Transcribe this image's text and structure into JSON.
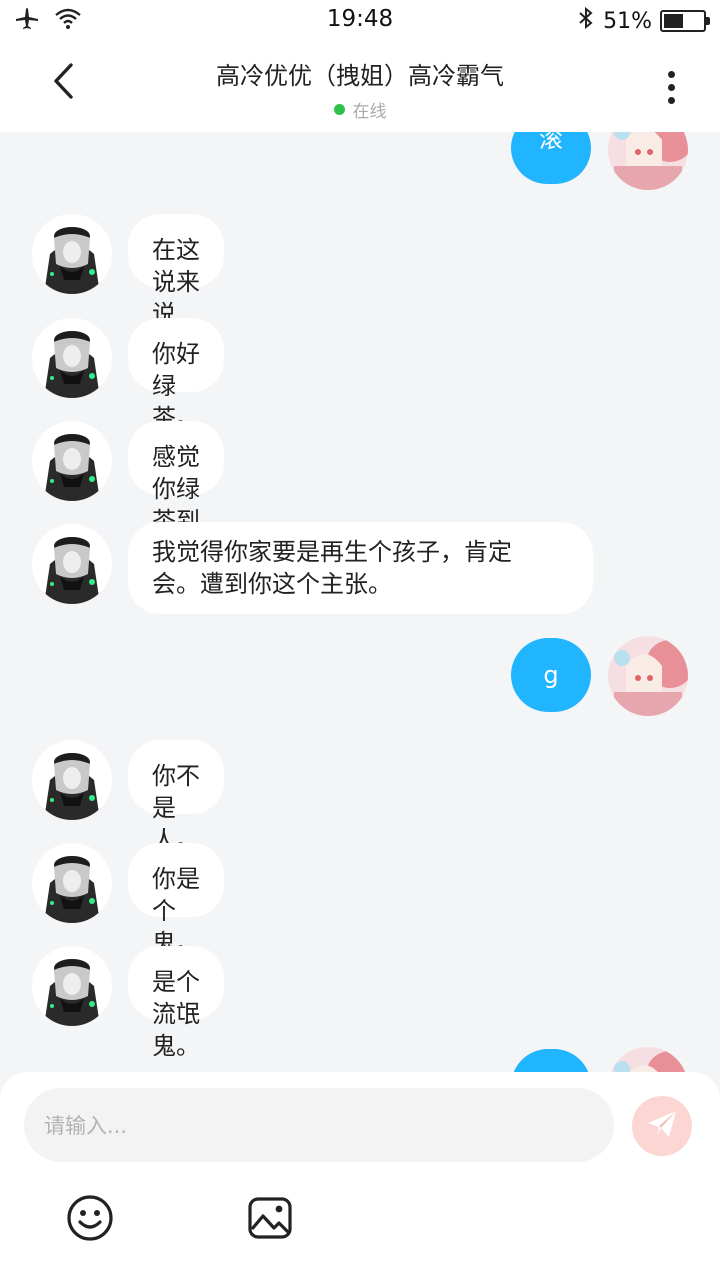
{
  "status_bar": {
    "time": "19:48",
    "battery_percent": "51%",
    "battery_level": 0.51
  },
  "header": {
    "title": "高冷优优（拽姐）高冷霸气",
    "status": "在线"
  },
  "messages": [
    {
      "side": "right",
      "text": "滚"
    },
    {
      "side": "left",
      "text": "在这说来说去。"
    },
    {
      "side": "left",
      "text": "你好绿茶。"
    },
    {
      "side": "left",
      "text": "感觉你绿茶到家。"
    },
    {
      "side": "left",
      "lines": [
        "我觉得你家要是再生个孩子，肯定",
        "会。遭到你这个主张。"
      ]
    },
    {
      "side": "right",
      "text": "g"
    },
    {
      "side": "left",
      "text": "你不是人。"
    },
    {
      "side": "left",
      "text": "你是个鬼。"
    },
    {
      "side": "left",
      "text": "是个流氓鬼。"
    },
    {
      "side": "right",
      "text": ""
    }
  ],
  "input": {
    "placeholder": "请输入..."
  },
  "icons": {
    "airplane": "airplane-icon",
    "wifi": "wifi-icon",
    "bluetooth": "bluetooth-icon",
    "back": "chevron-left-icon",
    "more": "more-vertical-icon",
    "send": "send-icon",
    "emoji": "smiley-icon",
    "image": "image-icon"
  },
  "colors": {
    "bubble_right": "#21b4ff",
    "bubble_left": "#ffffff",
    "online_dot": "#2ec24a",
    "send_button": "#fcd6d2"
  }
}
